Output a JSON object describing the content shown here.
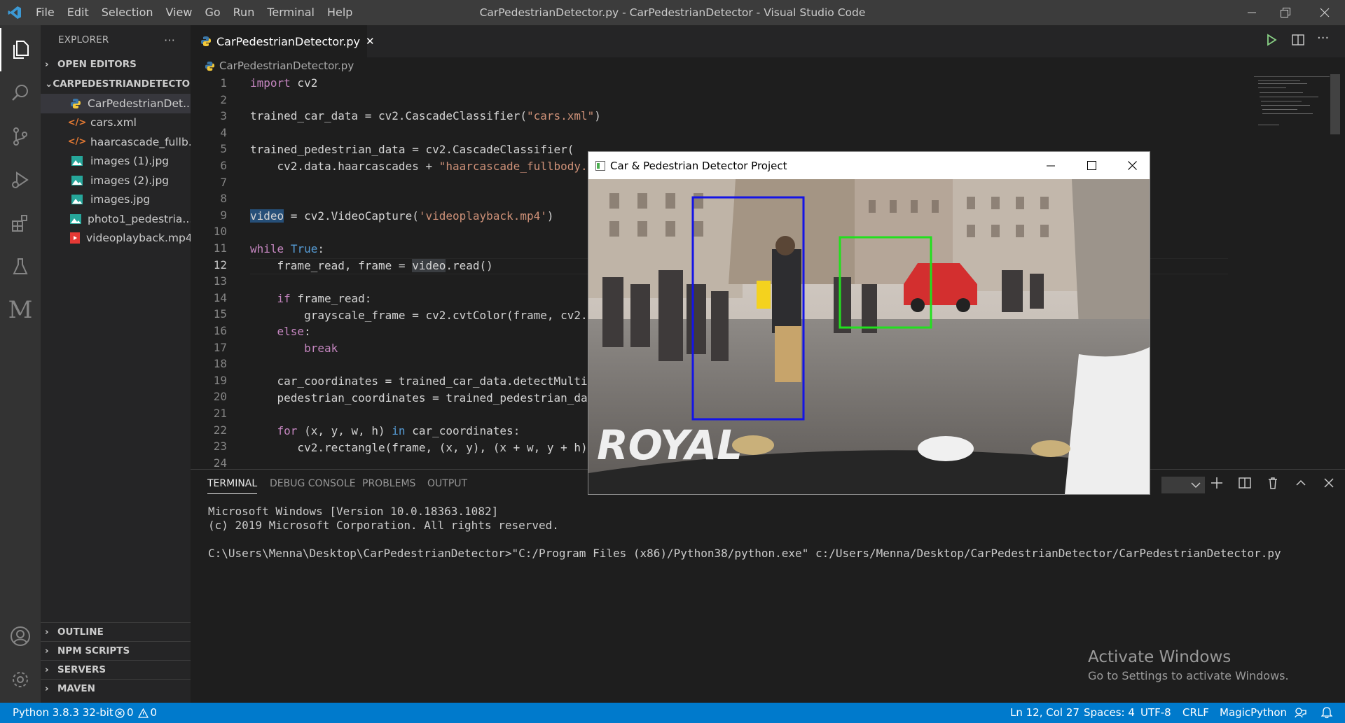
{
  "titlebar": {
    "menu": [
      "File",
      "Edit",
      "Selection",
      "View",
      "Go",
      "Run",
      "Terminal",
      "Help"
    ],
    "window_title": "CarPedestrianDetector.py - CarPedestrianDetector - Visual Studio Code"
  },
  "activitybar": {
    "items": [
      "files-icon",
      "search-icon",
      "source-control-icon",
      "run-debug-icon",
      "extensions-icon",
      "testing-icon",
      "m-icon"
    ],
    "bottom": [
      "account-icon",
      "settings-gear-icon"
    ]
  },
  "sidebar": {
    "header": "EXPLORER",
    "more": "···",
    "open_editors": "OPEN EDITORS",
    "project": "CARPEDESTRIANDETECTOR",
    "files": [
      {
        "name": "CarPedestrianDet...",
        "icon": "python-icon"
      },
      {
        "name": "cars.xml",
        "icon": "xml-icon"
      },
      {
        "name": "haarcascade_fullb...",
        "icon": "xml-icon"
      },
      {
        "name": "images (1).jpg",
        "icon": "image-icon"
      },
      {
        "name": "images (2).jpg",
        "icon": "image-icon"
      },
      {
        "name": "images.jpg",
        "icon": "image-icon"
      },
      {
        "name": "photo1_pedestria...",
        "icon": "image-icon"
      },
      {
        "name": "videoplayback.mp4",
        "icon": "video-icon"
      }
    ],
    "bottom_sections": [
      "OUTLINE",
      "NPM SCRIPTS",
      "SERVERS",
      "MAVEN"
    ]
  },
  "tab": {
    "label": "CarPedestrianDetector.py",
    "close": "✕"
  },
  "breadcrumb": "CarPedestrianDetector.py",
  "editor": {
    "line_numbers": [
      "1",
      "2",
      "3",
      "4",
      "5",
      "6",
      "7",
      "8",
      "9",
      "10",
      "11",
      "12",
      "13",
      "14",
      "15",
      "16",
      "17",
      "18",
      "19",
      "20",
      "21",
      "22",
      "23",
      "24"
    ]
  },
  "panel": {
    "tabs": [
      "TERMINAL",
      "DEBUG CONSOLE",
      "PROBLEMS",
      "OUTPUT"
    ],
    "terminal_lines": [
      "Microsoft Windows [Version 10.0.18363.1082]",
      "(c) 2019 Microsoft Corporation. All rights reserved.",
      "",
      "C:\\Users\\Menna\\Desktop\\CarPedestrianDetector>\"C:/Program Files (x86)/Python38/python.exe\" c:/Users/Menna/Desktop/CarPedestrianDetector/CarPedestrianDetector.py"
    ]
  },
  "cv_window": {
    "title": "Car & Pedestrian Detector Project",
    "watermark": "ROYAL",
    "car_box_color": "#22e01e",
    "pedestrian_box_color": "#1414e6"
  },
  "activate_windows": {
    "title": "Activate Windows",
    "subtitle": "Go to Settings to activate Windows."
  },
  "statusbar": {
    "python": "Python 3.8.3 32-bit",
    "errors": "0",
    "warnings": "0",
    "position": "Ln 12, Col 27",
    "spaces": "Spaces: 4",
    "encoding": "UTF-8",
    "eol": "CRLF",
    "language": "MagicPython"
  }
}
